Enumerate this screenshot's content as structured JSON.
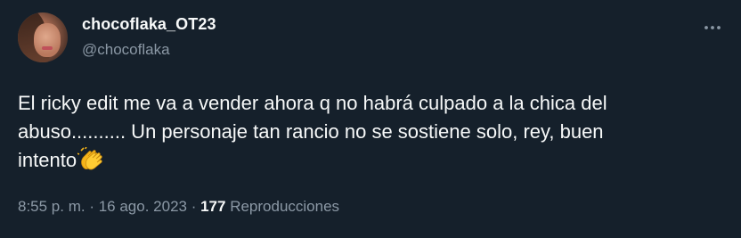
{
  "user": {
    "display_name": "chocoflaka_OT23",
    "handle": "@chocoflaka"
  },
  "tweet": {
    "line1": "El ricky edit me va a vender ahora q no habrá culpado a la chica del",
    "line2": "abuso.......... Un personaje tan rancio no se sostiene solo, rey, buen",
    "line3": "intento",
    "emoji": "clapping-hands-emoji"
  },
  "meta": {
    "time": "8:55 p. m.",
    "sep1": " · ",
    "date": "16 ago. 2023",
    "sep2": " · ",
    "views_count": "177",
    "views_label": " Reproducciones"
  },
  "icons": {
    "more": "more-horizontal-icon"
  },
  "colors": {
    "background": "#15202b",
    "text_primary": "#f7f9f9",
    "text_secondary": "#8b98a5"
  }
}
